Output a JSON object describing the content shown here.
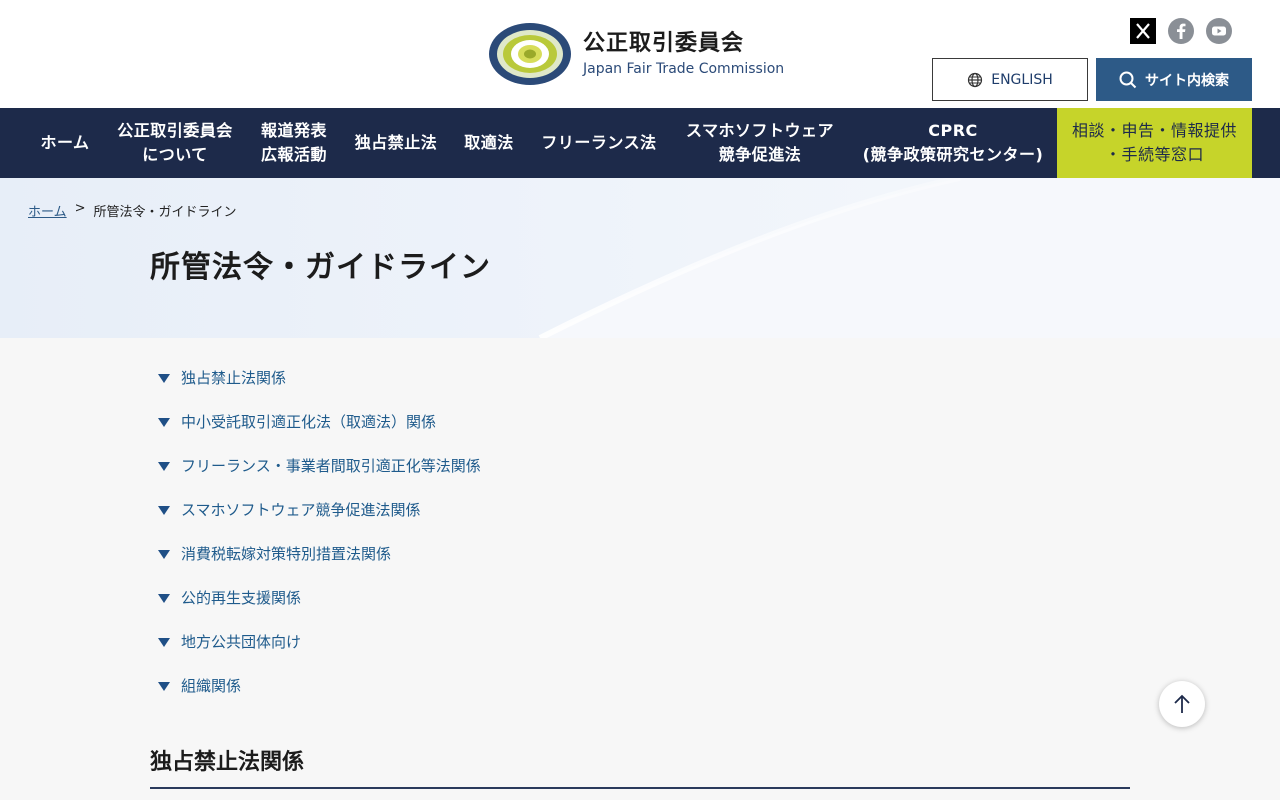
{
  "header": {
    "org_name_ja": "公正取引委員会",
    "org_name_en": "Japan Fair Trade Commission",
    "logo_ring_text": "JAPAN FAIR TRADE COMMISSION",
    "english_button": "ENGLISH",
    "search_button": "サイト内検索",
    "social": [
      "x-icon",
      "facebook-icon",
      "youtube-icon"
    ]
  },
  "nav": {
    "items": [
      {
        "label": "ホーム"
      },
      {
        "label": "公正取引委員会\nについて"
      },
      {
        "label": "報道発表\n広報活動"
      },
      {
        "label": "独占禁止法"
      },
      {
        "label": "取適法"
      },
      {
        "label": "フリーランス法"
      },
      {
        "label": "スマホソフトウェア\n競争促進法"
      },
      {
        "label": "CPRC\n(競争政策研究センター)"
      },
      {
        "label": "相談・申告・情報提供\n・手続等窓口"
      }
    ]
  },
  "breadcrumb": {
    "home": "ホーム",
    "separator": ">",
    "current": "所管法令・ガイドライン"
  },
  "page_title": "所管法令・ガイドライン",
  "toc": {
    "items": [
      {
        "label": "独占禁止法関係"
      },
      {
        "label": "中小受託取引適正化法（取適法）関係"
      },
      {
        "label": "フリーランス・事業者間取引適正化等法関係"
      },
      {
        "label": "スマホソフトウェア競争促進法関係"
      },
      {
        "label": "消費税転嫁対策特別措置法関係"
      },
      {
        "label": "公的再生支援関係"
      },
      {
        "label": "地方公共団体向け"
      },
      {
        "label": "組織関係"
      }
    ]
  },
  "section": {
    "title": "独占禁止法関係"
  },
  "colors": {
    "nav_bg": "#1d2a4a",
    "cta_bg": "#c6d42a",
    "search_bg": "#2d5a87",
    "link": "#1f5b8c"
  }
}
